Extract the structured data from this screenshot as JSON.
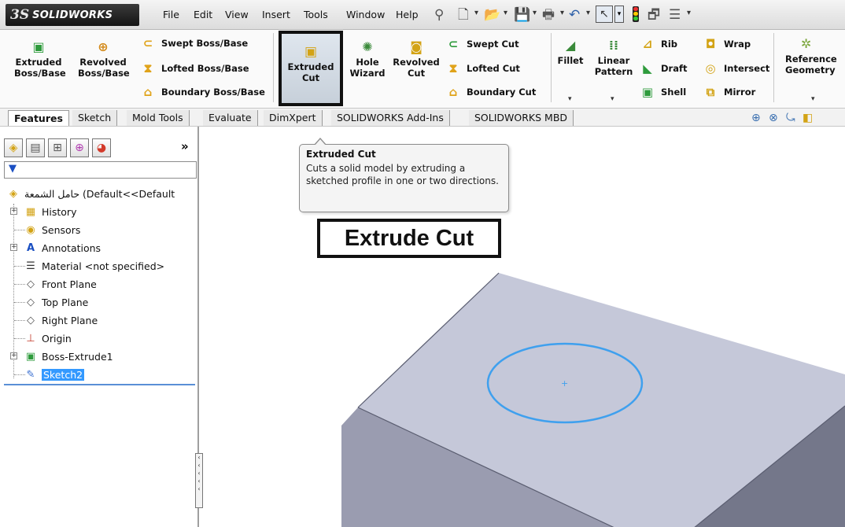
{
  "app": {
    "brand": "SOLIDWORKS",
    "ds": "3S"
  },
  "menu": [
    "File",
    "Edit",
    "View",
    "Insert",
    "Tools",
    "Window",
    "Help"
  ],
  "features": {
    "extruded_boss": [
      "Extruded",
      "Boss/Base"
    ],
    "revolved_boss": [
      "Revolved",
      "Boss/Base"
    ],
    "swept_boss": "Swept Boss/Base",
    "lofted_boss": "Lofted Boss/Base",
    "boundary_boss": "Boundary Boss/Base",
    "extruded_cut": [
      "Extruded",
      "Cut"
    ],
    "hole_wizard": [
      "Hole",
      "Wizard"
    ],
    "revolved_cut": [
      "Revolved",
      "Cut"
    ],
    "swept_cut": "Swept Cut",
    "lofted_cut": "Lofted Cut",
    "boundary_cut": "Boundary Cut",
    "fillet": "Fillet",
    "linear_pattern": [
      "Linear",
      "Pattern"
    ],
    "rib": "Rib",
    "draft": "Draft",
    "shell": "Shell",
    "wrap": "Wrap",
    "intersect": "Intersect",
    "mirror": "Mirror",
    "reference_geometry": [
      "Reference",
      "Geometry"
    ]
  },
  "tabs": [
    "Features",
    "Sketch",
    "Mold Tools",
    "Evaluate",
    "DimXpert",
    "SOLIDWORKS Add-Ins",
    "SOLIDWORKS MBD"
  ],
  "tree": {
    "root": "حامل الشمعة  (Default<<Default",
    "items": [
      "History",
      "Sensors",
      "Annotations",
      "Material <not specified>",
      "Front Plane",
      "Top Plane",
      "Right Plane",
      "Origin",
      "Boss-Extrude1",
      "Sketch2"
    ]
  },
  "tooltip": {
    "title": "Extruded Cut",
    "description": "Cuts a solid model by extruding a sketched profile in one or two directions."
  },
  "caption": "Extrude Cut",
  "colors": {
    "cube_top": "#c5c8d9",
    "cube_left": "#9a9cb0",
    "cube_right": "#74778a",
    "sketch_circle": "#3fa0ee",
    "selection": "#3399ff"
  }
}
